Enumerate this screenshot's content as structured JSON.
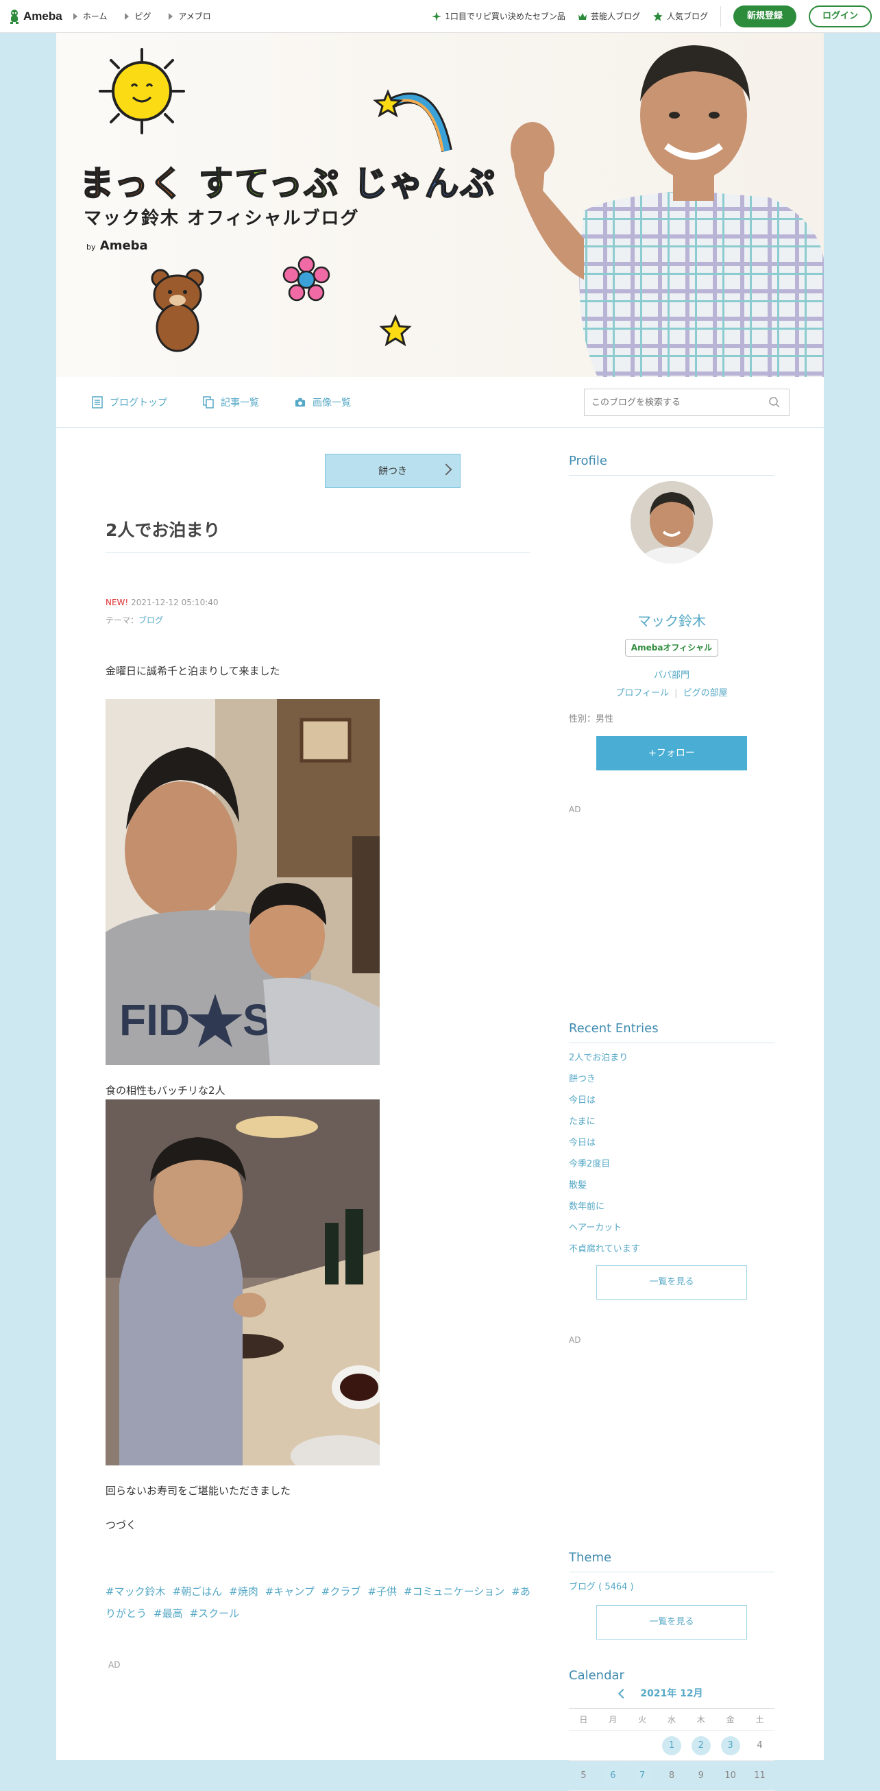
{
  "topbar": {
    "logo": "Ameba",
    "nav": [
      "ホーム",
      "ピグ",
      "アメブロ"
    ],
    "links": [
      "1口目でリピ買い決めたセブン品",
      "芸能人ブログ",
      "人気ブログ"
    ],
    "register": "新規登録",
    "login": "ログイン"
  },
  "banner": {
    "title1": "まっく",
    "title2": "すてっぷ",
    "title3": "じゃんぷ",
    "subtitle": "マック鈴木 オフィシャルブログ",
    "by": "by",
    "byname": "Ameba"
  },
  "blognav": {
    "items": [
      "ブログトップ",
      "記事一覧",
      "画像一覧"
    ],
    "search_placeholder": "このブログを検索する"
  },
  "article": {
    "prev_label": "餅つき",
    "title": "2人でお泊まり",
    "new_label": "NEW!",
    "datetime": "2021-12-12 05:10:40",
    "theme_label": "テーマ：",
    "theme_value": "ブログ",
    "para1": "金曜日に誠希千と泊まりして来ました",
    "para2": "食の相性もバッチリな2人",
    "para3": "回らないお寿司をご堪能いただきました",
    "para4": "つづく",
    "tags": [
      "#マック鈴木",
      "#朝ごはん",
      "#焼肉",
      "#キャンプ",
      "#クラブ",
      "#子供",
      "#コミュニケーション",
      "#ありがとう",
      "#最高",
      "#スクール"
    ],
    "ad": "AD"
  },
  "sidebar": {
    "profile_heading": "Profile",
    "name": "マック鈴木",
    "badge": "Amebaオフィシャル",
    "category": "パパ部門",
    "link_profile": "プロフィール",
    "link_pig": "ピグの部屋",
    "gender": "性別：男性",
    "follow": "+フォロー",
    "ad1": "AD",
    "recent_heading": "Recent Entries",
    "recent": [
      "2人でお泊まり",
      "餅つき",
      "今日は",
      "たまに",
      "今日は",
      "今季2度目",
      "散髪",
      "数年前に",
      "ヘアーカット",
      "不貞腐れています"
    ],
    "more1": "一覧を見る",
    "ad2": "AD",
    "theme_heading": "Theme",
    "theme_item": "ブログ ( 5464 )",
    "more2": "一覧を見る",
    "calendar_heading": "Calendar",
    "calendar_month": "2021年 12月",
    "weekdays": [
      "日",
      "月",
      "火",
      "水",
      "木",
      "金",
      "土"
    ],
    "week1": [
      "",
      "",
      "",
      "1",
      "2",
      "3",
      "4"
    ],
    "week2": [
      "5",
      "6",
      "7",
      "8",
      "9",
      "10",
      "11"
    ]
  },
  "colors": {
    "accent": "#55a8c6",
    "brand_green": "#2d8c3c",
    "page_bg": "#cde8f0"
  }
}
